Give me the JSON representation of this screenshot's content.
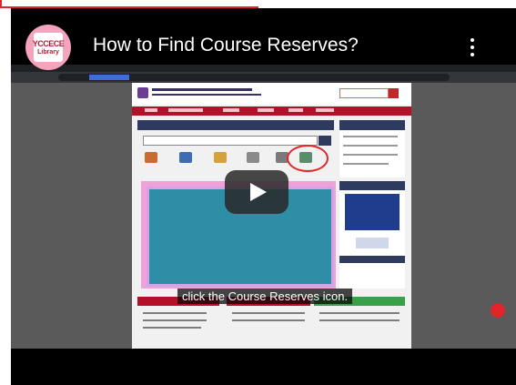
{
  "channel": {
    "name_line1": "YCCECE",
    "name_line2": "Library"
  },
  "video": {
    "title": "How to Find Course Reserves?",
    "caption": "click the Course Reserves icon."
  },
  "icons": {
    "more": "more-vert-icon",
    "play": "play-icon"
  },
  "colors": {
    "accent_red": "#e0262b",
    "site_nav": "#b3102a",
    "site_header_blue": "#2e3a5e",
    "banner_pink": "#f0a1da",
    "banner_teal": "#2e8ea6"
  }
}
